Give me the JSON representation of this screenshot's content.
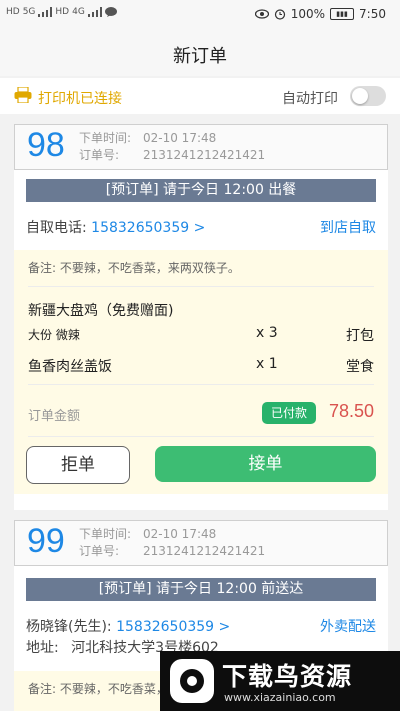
{
  "status_bar": {
    "left_indicators": [
      "HD",
      "5G",
      "HD",
      "4G"
    ],
    "battery": "100%",
    "time": "7:50"
  },
  "header": {
    "title": "新订单"
  },
  "printer": {
    "status": "打印机已连接",
    "auto_print_label": "自动打印",
    "auto_print_on": false,
    "status_color": "#e0a800"
  },
  "labels": {
    "order_time": "下单时间:",
    "order_id": "订单号:",
    "note_prefix": "备注:",
    "amount": "订单金额",
    "paid": "已付款",
    "reject": "拒单",
    "accept": "接单",
    "address_prefix": "地址:"
  },
  "orders": [
    {
      "number": "98",
      "time": "02-10   17:48",
      "order_id": "2131241212421421",
      "banner": "[预订单] 请于今日 12:00 出餐",
      "contact_label": "自取电话:",
      "phone": "15832650359 >",
      "delivery": "到店自取",
      "note": "不要辣，不吃香菜，来两双筷子。",
      "items": [
        {
          "name": "新疆大盘鸡（免费赠面)",
          "spec": "大份   微辣",
          "qty": "x 3",
          "tag": "打包"
        },
        {
          "name": "鱼香肉丝盖饭",
          "qty": "x 1",
          "tag": "堂食"
        }
      ],
      "amount": "78.50"
    },
    {
      "number": "99",
      "time": "02-10   17:48",
      "order_id": "2131241212421421",
      "banner": "[预订单] 请于今日 12:00 前送达",
      "contact_label": "杨晓锋(先生):",
      "phone": "15832650359 >",
      "delivery": "外卖配送",
      "address": "河北科技大学3号楼602",
      "note": "不要辣，不吃香菜，来两双筷子。"
    }
  ],
  "watermark": {
    "title": "下载鸟资源",
    "url": "www.xiazainiao.com"
  },
  "colors": {
    "accent": "#1e88e5",
    "accept": "#3dbd73",
    "price": "#d9534f",
    "banner": "#6a7a93"
  }
}
